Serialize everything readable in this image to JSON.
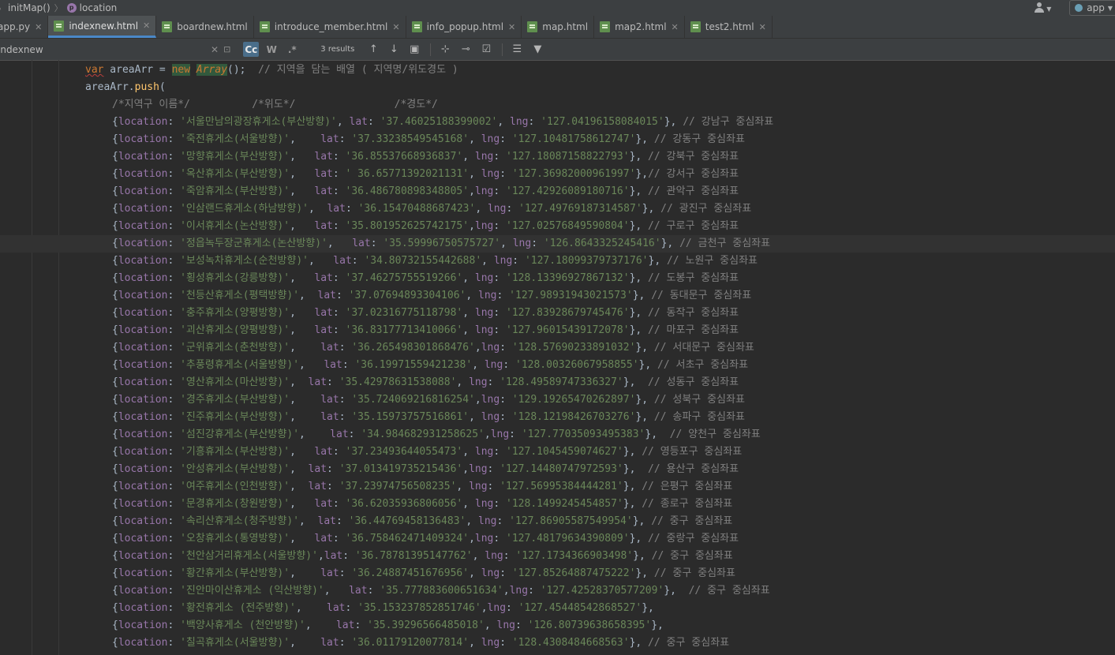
{
  "breadcrumb": {
    "item1": "initMap()",
    "item2_badge": "p",
    "item2": "location"
  },
  "toolbar": {
    "run_config": "app"
  },
  "tabs": [
    {
      "label": "app.py",
      "icon": "python-file-icon",
      "active": false,
      "closable": true
    },
    {
      "label": "indexnew.html",
      "icon": "html-file-icon",
      "active": true,
      "closable": true
    },
    {
      "label": "boardnew.html",
      "icon": "html-file-icon",
      "active": false,
      "closable": false
    },
    {
      "label": "introduce_member.html",
      "icon": "html-file-icon",
      "active": false,
      "closable": true
    },
    {
      "label": "info_popup.html",
      "icon": "html-file-icon",
      "active": false,
      "closable": true
    },
    {
      "label": "map.html",
      "icon": "html-file-icon",
      "active": false,
      "closable": false
    },
    {
      "label": "map2.html",
      "icon": "html-file-icon",
      "active": false,
      "closable": true
    },
    {
      "label": "test2.html",
      "icon": "html-file-icon",
      "active": false,
      "closable": true
    }
  ],
  "search": {
    "query": "indexnew",
    "results": "3 results",
    "opt_case": "Cc",
    "opt_word": "W",
    "opt_regex": ".*"
  },
  "code": {
    "line0": {
      "kw_var": "var",
      "name": " areaArr = ",
      "kw_new": "new",
      "sp": " ",
      "cls": "Array",
      "rest": "();",
      "comment": "  // 지역을 담는 배열 ( 지역명/위도경도 )"
    },
    "line1": {
      "obj": "areaArr.",
      "fn": "push",
      "rest": "("
    },
    "line2": {
      "comment": "/*지역구 이름*/          /*위도*/                /*경도*/"
    },
    "entries": [
      {
        "name": "'서울만남의광장휴게소(부산방향)'",
        "g1": ", ",
        "lat": "'37.46025188399002'",
        "g2": ", ",
        "lng": "'127.04196158084015'",
        "end": "},",
        "comment": " // 강남구 중심좌표"
      },
      {
        "name": "'죽전휴게소(서울방향)'",
        "g1": ",    ",
        "lat": "'37.33238549545168'",
        "g2": ", ",
        "lng": "'127.10481758612747'",
        "end": "},",
        "comment": " // 강동구 중심좌표"
      },
      {
        "name": "'망향휴게소(부산방향)'",
        "g1": ",   ",
        "lat": "'36.85537668936837'",
        "g2": ", ",
        "lng": "'127.18087158822793'",
        "end": "},",
        "comment": " // 강북구 중심좌표"
      },
      {
        "name": "'옥산휴게소(부산방향)'",
        "g1": ",   ",
        "lat": "' 36.65771392021131'",
        "g2": ", ",
        "lng": "'127.36982000961997'",
        "end": "},",
        "comment": "// 강서구 중심좌표"
      },
      {
        "name": "'죽암휴게소(부산방향)'",
        "g1": ",   ",
        "lat": "'36.486780898348805'",
        "g2": ",",
        "lng": "'127.42926089180716'",
        "end": "},",
        "comment": " // 관악구 중심좌표"
      },
      {
        "name": "'인삼랜드휴게소(하남방향)'",
        "g1": ",  ",
        "lat": "'36.15470488687423'",
        "g2": ", ",
        "lng": "'127.49769187314587'",
        "end": "},",
        "comment": " // 광진구 중심좌표"
      },
      {
        "name": "'이서휴게소(논산방향)'",
        "g1": ",   ",
        "lat": "'35.801952625742175'",
        "g2": ",",
        "lng": "'127.02576849590804'",
        "end": "},",
        "comment": " // 구로구 중심좌표"
      },
      {
        "name": "'정읍녹두장군휴게소(논산방향)'",
        "g1": ",   ",
        "lat": "'35.59996750575727'",
        "g2": ", ",
        "lng": "'126.8643325245416'",
        "end": "},",
        "comment": " // 금천구 중심좌표"
      },
      {
        "name": "'보성녹차휴게소(순천방향)'",
        "g1": ",   ",
        "lat": "'34.80732155442688'",
        "g2": ", ",
        "lng": "'127.18099379737176'",
        "end": "},",
        "comment": " // 노원구 중심좌표"
      },
      {
        "name": "'횡성휴게소(강릉방향)'",
        "g1": ",   ",
        "lat": "'37.46275755519266'",
        "g2": ", ",
        "lng": "'128.13396927867132'",
        "end": "},",
        "comment": " // 도봉구 중심좌표"
      },
      {
        "name": "'천등산휴게소(평택방향)'",
        "g1": ",  ",
        "lat": "'37.07694893304106'",
        "g2": ", ",
        "lng": "'127.98931943021573'",
        "end": "},",
        "comment": " // 동대문구 중심좌표"
      },
      {
        "name": "'충주휴게소(양평방향)'",
        "g1": ",   ",
        "lat": "'37.02316775118798'",
        "g2": ", ",
        "lng": "'127.83928679745476'",
        "end": "},",
        "comment": " // 동작구 중심좌표"
      },
      {
        "name": "'괴산휴게소(양평방향)'",
        "g1": ",   ",
        "lat": "'36.83177713410066'",
        "g2": ", ",
        "lng": "'127.96015439172078'",
        "end": "},",
        "comment": " // 마포구 중심좌표"
      },
      {
        "name": "'군위휴게소(춘천방향)'",
        "g1": ",    ",
        "lat": "'36.265498301868476'",
        "g2": ",",
        "lng": "'128.57690233891032'",
        "end": "},",
        "comment": " // 서대문구 중심좌표"
      },
      {
        "name": "'추풍령휴게소(서울방향)'",
        "g1": ",   ",
        "lat": "'36.19971559421238'",
        "g2": ", ",
        "lng": "'128.00326067958855'",
        "end": "},",
        "comment": " // 서초구 중심좌표"
      },
      {
        "name": "'영산휴게소(마산방향)'",
        "g1": ",  ",
        "lat": "'35.42978631538088'",
        "g2": ", ",
        "lng": "'128.49589747336327'",
        "end": "},",
        "comment": "  // 성동구 중심좌표"
      },
      {
        "name": "'경주휴게소(부산방향)'",
        "g1": ",    ",
        "lat": "'35.724069216816254'",
        "g2": ",",
        "lng": "'129.19265470262897'",
        "end": "},",
        "comment": " // 성북구 중심좌표"
      },
      {
        "name": "'진주휴게소(부산방향)'",
        "g1": ",    ",
        "lat": "'35.15973757516861'",
        "g2": ", ",
        "lng": "'128.12198426703276'",
        "end": "},",
        "comment": " // 송파구 중심좌표"
      },
      {
        "name": "'섬진강휴게소(부산방향)'",
        "g1": ",    ",
        "lat": "'34.984682931258625'",
        "g2": ",",
        "lng": "'127.77035093495383'",
        "end": "},",
        "comment": "  // 양천구 중심좌표"
      },
      {
        "name": "'기흥휴게소(부산방향)'",
        "g1": ",   ",
        "lat": "'37.23493644055473'",
        "g2": ", ",
        "lng": "'127.1045459074627'",
        "end": "},",
        "comment": " // 영등포구 중심좌표"
      },
      {
        "name": "'안성휴게소(부산방향)'",
        "g1": ",  ",
        "lat": "'37.013419735215436'",
        "g2": ",",
        "lng": "'127.14480747972593'",
        "end": "},",
        "comment": "  // 용산구 중심좌표"
      },
      {
        "name": "'여주휴게소(인천방향)'",
        "g1": ",  ",
        "lat": "'37.23974756508235'",
        "g2": ", ",
        "lng": "'127.56995384444281'",
        "end": "},",
        "comment": " // 은평구 중심좌표"
      },
      {
        "name": "'문경휴게소(창원방향)'",
        "g1": ",   ",
        "lat": "'36.62035936806056'",
        "g2": ", ",
        "lng": "'128.1499245454857'",
        "end": "},",
        "comment": " // 종로구 중심좌표"
      },
      {
        "name": "'속리산휴게소(청주방향)'",
        "g1": ",  ",
        "lat": "'36.44769458136483'",
        "g2": ", ",
        "lng": "'127.86905587549954'",
        "end": "},",
        "comment": " // 중구 중심좌표"
      },
      {
        "name": "'오창휴게소(통영방향)'",
        "g1": ",   ",
        "lat": "'36.758462471409324'",
        "g2": ",",
        "lng": "'127.48179634390809'",
        "end": "},",
        "comment": " // 중랑구 중심좌표"
      },
      {
        "name": "'천안삼거리휴게소(서울방향)'",
        "g1": ",",
        "lat": "'36.78781395147762'",
        "g2": ", ",
        "lng": "'127.1734366903498'",
        "end": "},",
        "comment": " // 중구 중심좌표"
      },
      {
        "name": "'황간휴게소(부산방향)'",
        "g1": ",    ",
        "lat": "'36.24887451676956'",
        "g2": ", ",
        "lng": "'127.85264887475222'",
        "end": "},",
        "comment": " // 중구 중심좌표"
      },
      {
        "name": "'진안마이산휴게소 (익산방향)'",
        "g1": ",   ",
        "lat": "'35.777883600651634'",
        "g2": ",",
        "lng": "'127.42528370577209'",
        "end": "},",
        "comment": "  // 중구 중심좌표"
      },
      {
        "name": "'황전휴게소 (전주방향)'",
        "g1": ",    ",
        "lat": "'35.153237852851746'",
        "g2": ",",
        "lng": "'127.45448542868527'",
        "end": "},",
        "comment": ""
      },
      {
        "name": "'백양사휴게소 (천안방향)'",
        "g1": ",    ",
        "lat": "'35.39296566485018'",
        "g2": ", ",
        "lng": "'126.80739638658395'",
        "end": "},",
        "comment": ""
      },
      {
        "name": "'칠곡휴게소(서울방향)'",
        "g1": ",    ",
        "lat": "'36.01179120077814'",
        "g2": ", ",
        "lng": "'128.4308484668563'",
        "end": "},",
        "comment": " // 중구 중심좌표"
      }
    ]
  }
}
